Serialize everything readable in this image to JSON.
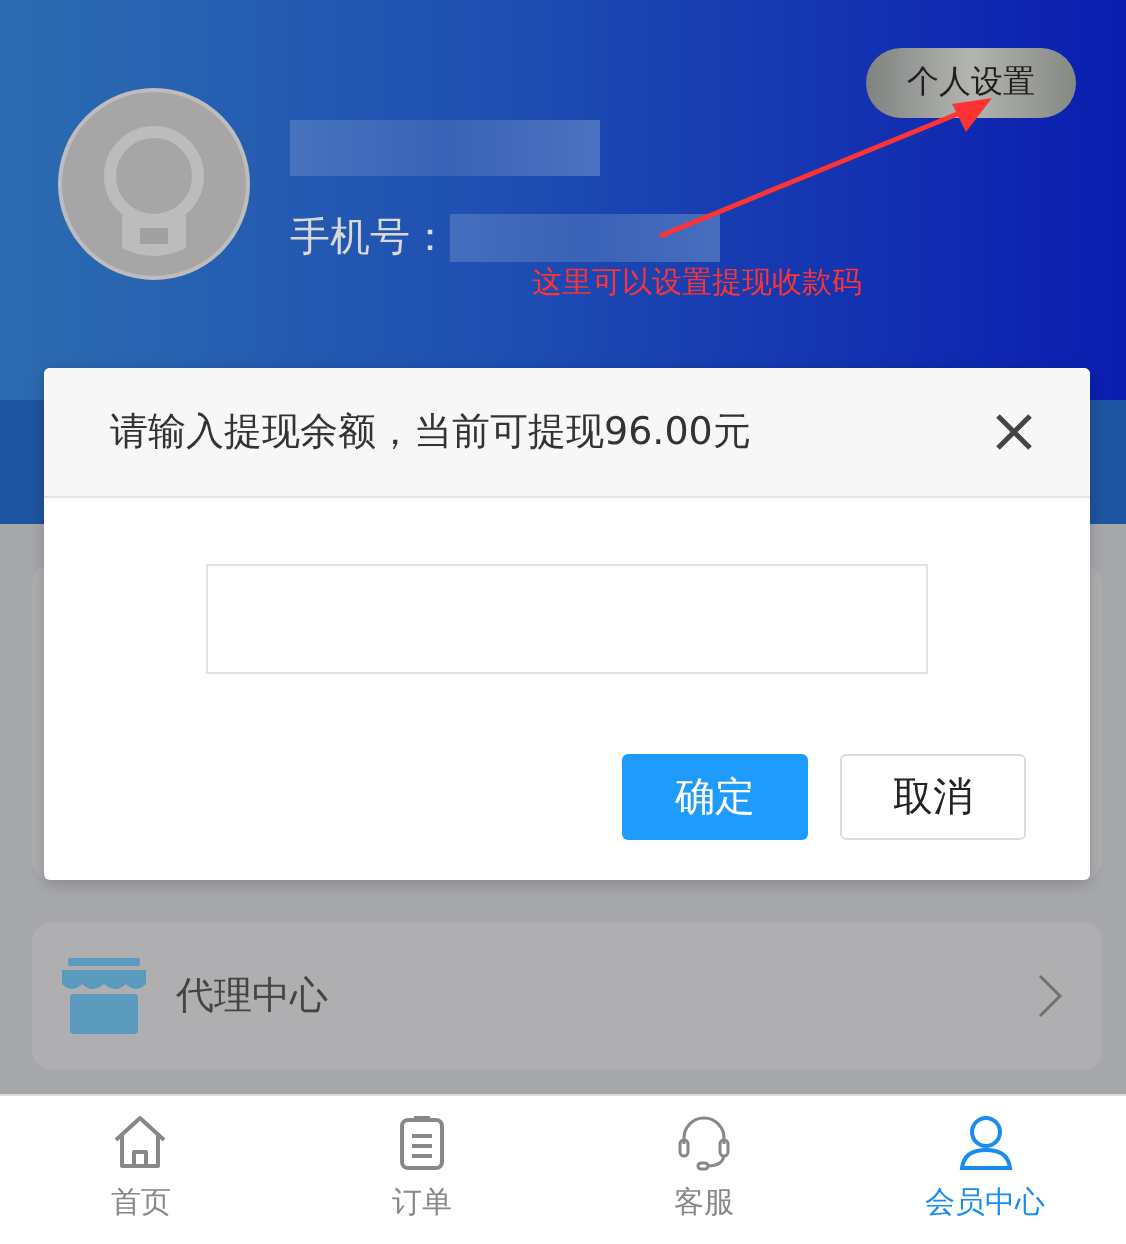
{
  "header": {
    "phone_label": "手机号：",
    "settings_button": "个人设置",
    "annotation": "这里可以设置提现收款码"
  },
  "dialog": {
    "title": "请输入提现余额，当前可提现96.00元",
    "buttons": [
      {
        "label": "确定",
        "kind": "primary"
      },
      {
        "label": "取消",
        "kind": "secondary"
      }
    ]
  },
  "menu": [
    {
      "label": "代理中心"
    }
  ],
  "tab_bar": [
    {
      "label": "首页",
      "selected": false
    },
    {
      "label": "订单",
      "selected": false
    },
    {
      "label": "客服",
      "selected": false
    },
    {
      "label": "会员中心",
      "selected": true
    }
  ]
}
